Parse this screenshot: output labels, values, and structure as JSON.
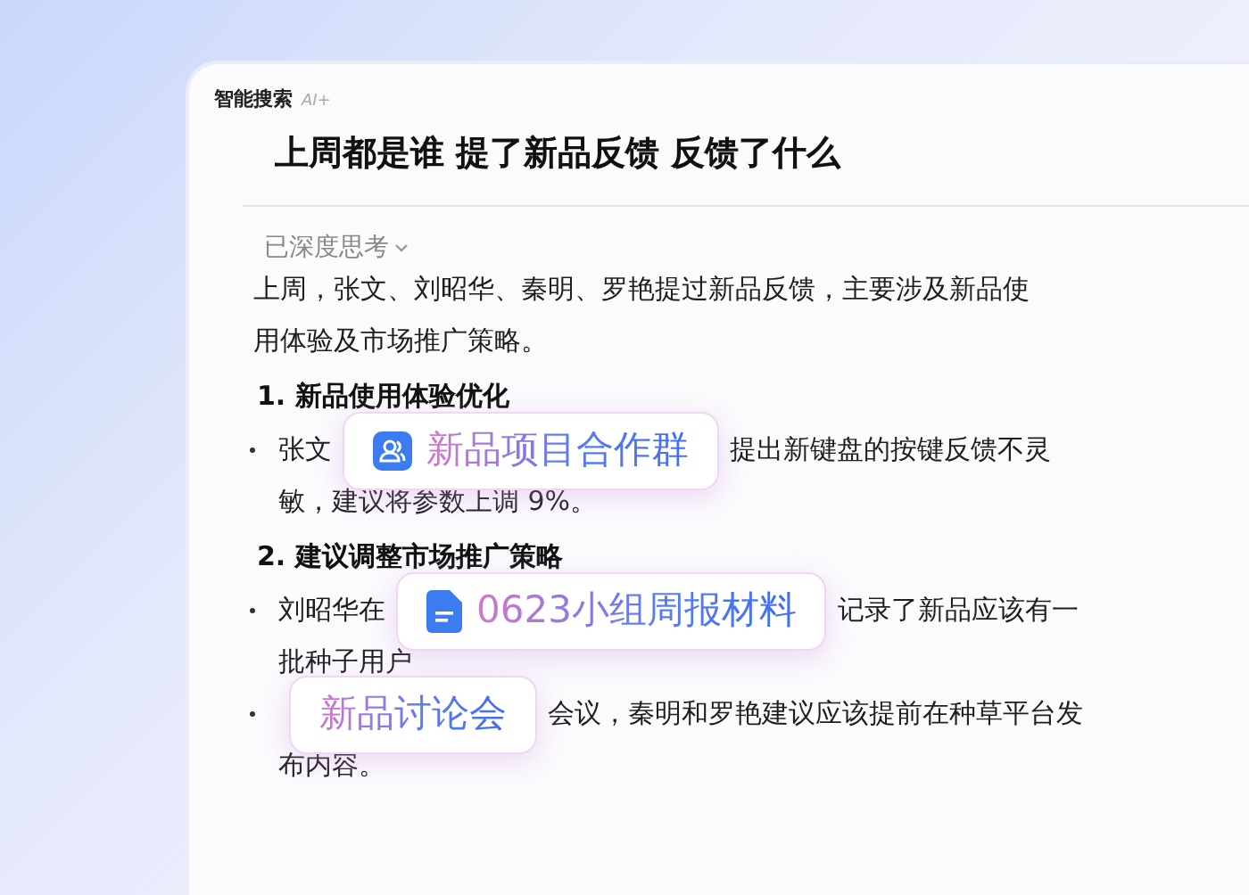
{
  "header": {
    "title": "智能搜索",
    "badge": "AI+"
  },
  "query": "上周都是谁 提了新品反馈 反馈了什么",
  "thinking": {
    "label": "已深度思考"
  },
  "summary": [
    "上周，张文、刘昭华、秦明、罗艳提过新品反馈，主要涉及新品使",
    "用体验及市场推广策略。"
  ],
  "sections": [
    {
      "heading": "1. 新品使用体验优化",
      "bullets": [
        {
          "lines": [
            [
              {
                "kind": "text",
                "text": "张文"
              },
              {
                "kind": "group_chip",
                "text": "新品项目合作群"
              },
              {
                "kind": "text",
                "text": "提出新键盘的按键反馈不灵"
              }
            ],
            [
              {
                "kind": "text",
                "text": "敏，建议将参数上调 9%。"
              }
            ]
          ]
        }
      ]
    },
    {
      "heading": "2. 建议调整市场推广策略",
      "bullets": [
        {
          "lines": [
            [
              {
                "kind": "text",
                "text": "刘昭华在"
              },
              {
                "kind": "doc_chip",
                "text": "0623小组周报材料"
              },
              {
                "kind": "text",
                "text": "记录了新品应该有一"
              }
            ],
            [
              {
                "kind": "text",
                "text": "批种子用户"
              }
            ]
          ]
        },
        {
          "lines": [
            [
              {
                "kind": "chip",
                "text": "新品讨论会"
              },
              {
                "kind": "text",
                "text": "会议，秦明和罗艳建议应该提前在种草平台发"
              }
            ],
            [
              {
                "kind": "text",
                "text": "布内容。"
              }
            ]
          ]
        }
      ]
    }
  ]
}
